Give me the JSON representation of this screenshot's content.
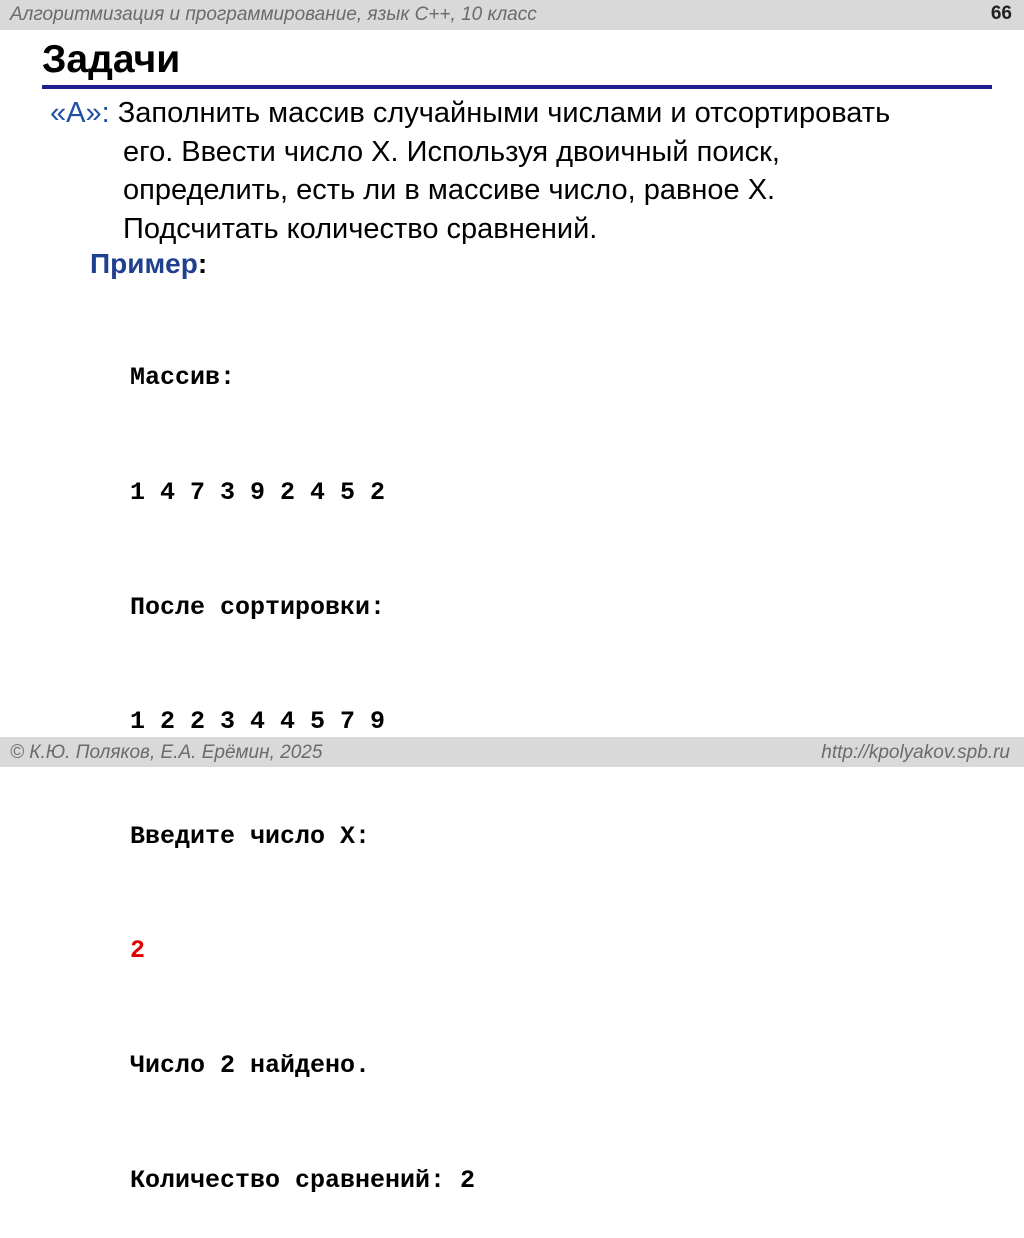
{
  "header": {
    "course": "Алгоритмизация и программирование, язык C++, 10 класс",
    "page_number": "66"
  },
  "title": "Задачи",
  "task": {
    "label": "«A»:",
    "lines": [
      " Заполнить массив случайными числами и отсортировать",
      "его.  Ввести число X. Используя двоичный поиск,",
      "определить, есть ли в массиве число, равное X.",
      "Подсчитать количество сравнений."
    ]
  },
  "example": {
    "label": "Пример",
    "colon": ":",
    "console_lines": [
      "Массив:",
      "1 4 7 3 9 2 4 5 2",
      "После сортировки:",
      "1 2 2 3 4 4 5 7 9",
      "Введите число X:",
      "2",
      "Число 2 найдено.",
      "Количество сравнений: 2"
    ],
    "input_color": "#e00000"
  },
  "footer": {
    "authors": "© К.Ю. Поляков, Е.А. Ерёмин, 2025",
    "url": "http://kpolyakov.spb.ru"
  },
  "colors": {
    "accent_label": "#1f4fa8",
    "title_rule": "#1f1f8f",
    "bars": "#d9d9d9"
  }
}
